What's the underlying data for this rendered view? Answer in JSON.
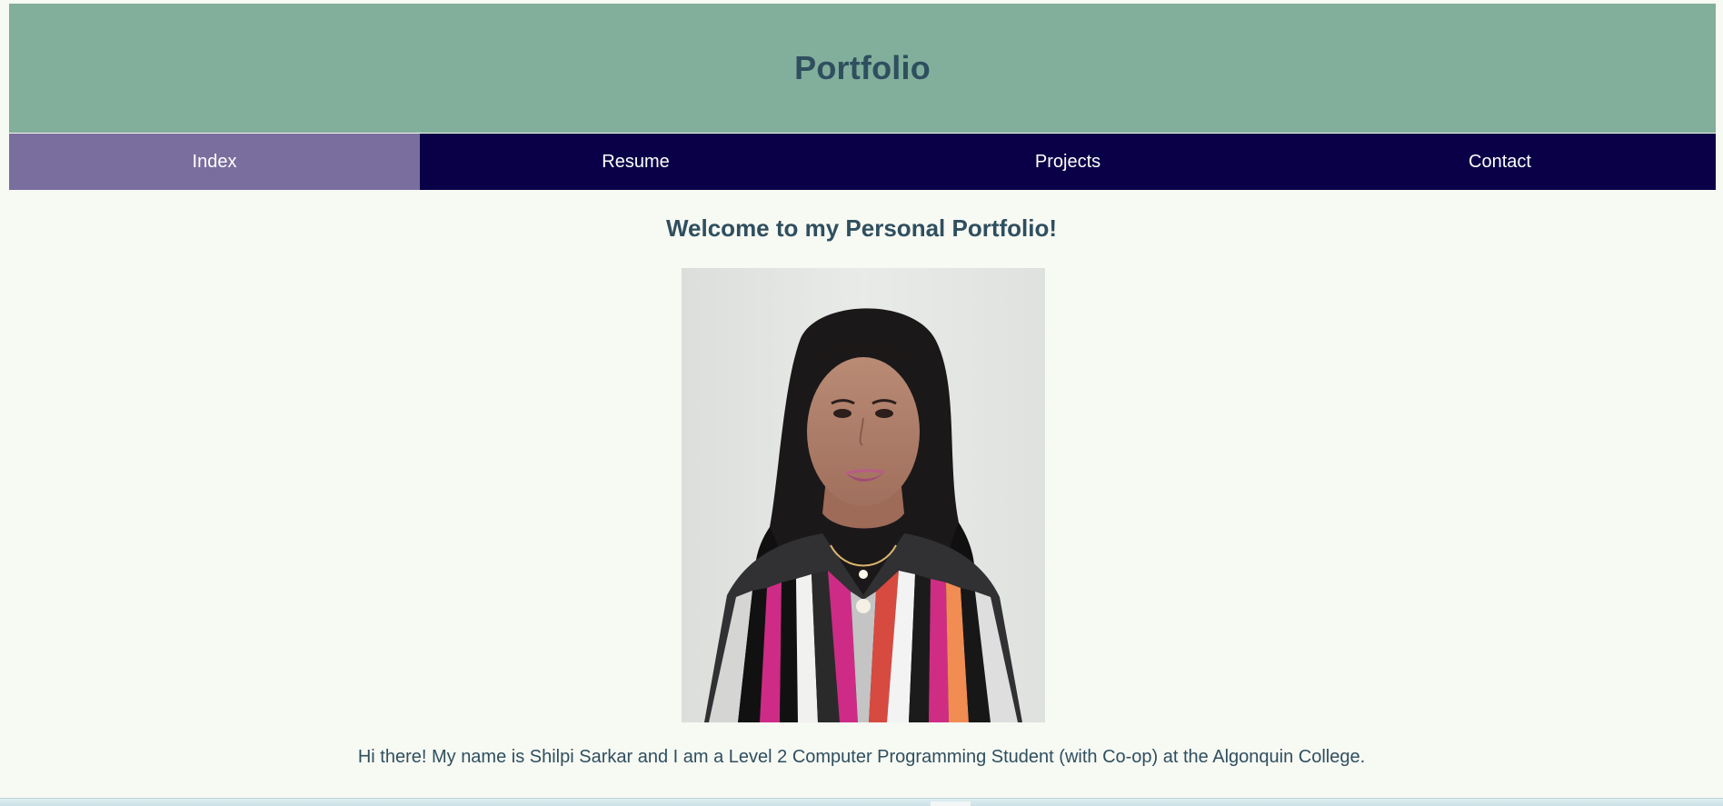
{
  "header": {
    "title": "Portfolio"
  },
  "nav": {
    "items": [
      {
        "label": "Index",
        "active": true
      },
      {
        "label": "Resume",
        "active": false
      },
      {
        "label": "Projects",
        "active": false
      },
      {
        "label": "Contact",
        "active": false
      }
    ]
  },
  "main": {
    "heading": "Welcome to my Personal Portfolio!",
    "intro": "Hi there! My name is Shilpi Sarkar and I am a Level 2 Computer Programming Student (with Co-op) at the Algonquin College."
  },
  "colors": {
    "header_bg": "#81af9b",
    "nav_bg": "#0a0048",
    "nav_active_bg": "#7a6e9f",
    "page_bg": "#f7f9f3",
    "heading_text": "#2f4f5f"
  },
  "icons": {
    "profile_photo": "portrait-photo"
  }
}
